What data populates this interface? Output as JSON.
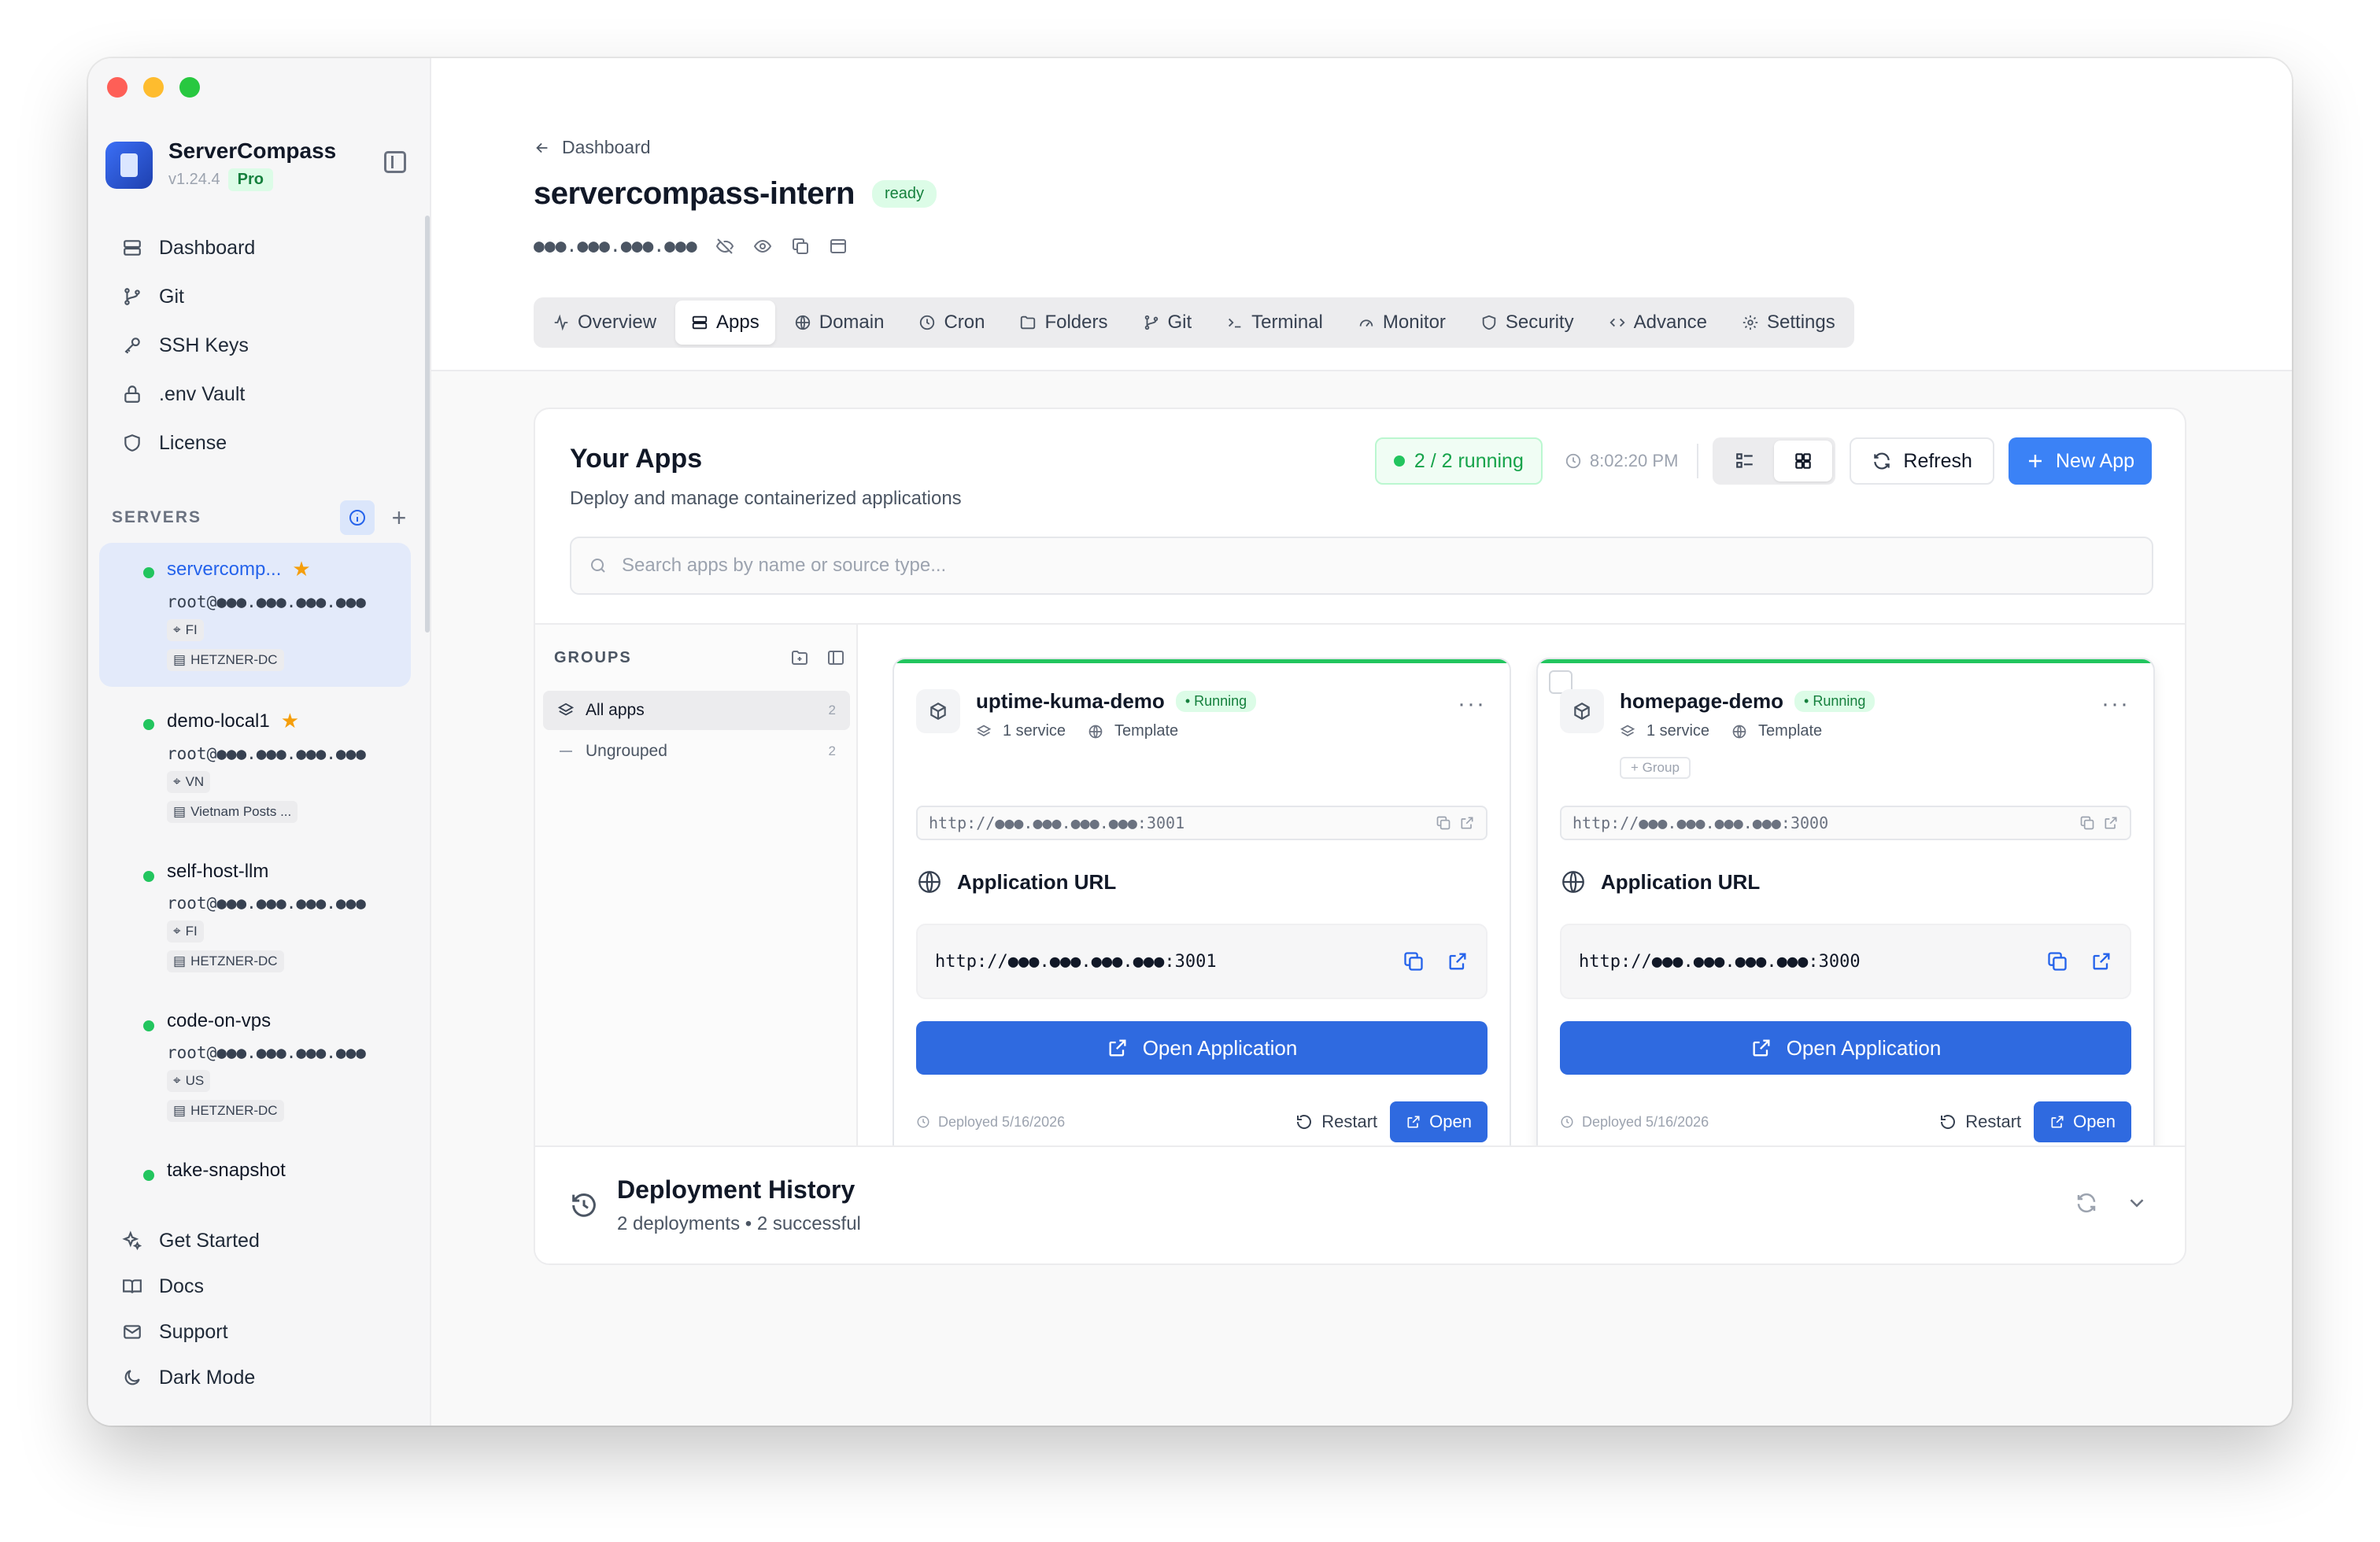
{
  "app": {
    "name": "ServerCompass",
    "version": "v1.24.4",
    "plan": "Pro"
  },
  "sidebar": {
    "nav": [
      {
        "label": "Dashboard",
        "icon": "dashboard-icon"
      },
      {
        "label": "Git",
        "icon": "git-branch-icon"
      },
      {
        "label": "SSH Keys",
        "icon": "key-icon"
      },
      {
        "label": ".env Vault",
        "icon": "lock-icon"
      },
      {
        "label": "License",
        "icon": "shield-icon"
      }
    ],
    "servers_title": "SERVERS",
    "servers": [
      {
        "name": "servercomp...",
        "user_ip": "root@●●●.●●●.●●●.●●●",
        "location": "FI",
        "provider": "HETZNER-DC",
        "starred": true,
        "active": true
      },
      {
        "name": "demo-local1",
        "user_ip": "root@●●●.●●●.●●●.●●●",
        "location": "VN",
        "provider": "Vietnam Posts ...",
        "starred": true,
        "active": false
      },
      {
        "name": "self-host-llm",
        "user_ip": "root@●●●.●●●.●●●.●●●",
        "location": "FI",
        "provider": "HETZNER-DC",
        "starred": false,
        "active": false
      },
      {
        "name": "code-on-vps",
        "user_ip": "root@●●●.●●●.●●●.●●●",
        "location": "US",
        "provider": "HETZNER-DC",
        "starred": false,
        "active": false
      },
      {
        "name": "take-snapshot",
        "user_ip": "",
        "location": "",
        "provider": "",
        "starred": false,
        "active": false
      }
    ],
    "footer": [
      {
        "label": "Get Started",
        "icon": "sparkles-icon"
      },
      {
        "label": "Docs",
        "icon": "book-icon"
      },
      {
        "label": "Support",
        "icon": "mail-icon"
      },
      {
        "label": "Dark Mode",
        "icon": "moon-icon"
      }
    ]
  },
  "header": {
    "breadcrumb": "Dashboard",
    "title": "servercompass-intern",
    "status": "ready",
    "ip_masked": "●●●.●●●.●●●.●●●"
  },
  "tabs": [
    {
      "label": "Overview",
      "icon": "activity-icon",
      "active": false
    },
    {
      "label": "Apps",
      "icon": "server-icon",
      "active": true
    },
    {
      "label": "Domain",
      "icon": "globe-icon",
      "active": false
    },
    {
      "label": "Cron",
      "icon": "clock-icon",
      "active": false
    },
    {
      "label": "Folders",
      "icon": "folder-icon",
      "active": false
    },
    {
      "label": "Git",
      "icon": "git-branch-icon",
      "active": false
    },
    {
      "label": "Terminal",
      "icon": "terminal-icon",
      "active": false
    },
    {
      "label": "Monitor",
      "icon": "gauge-icon",
      "active": false
    },
    {
      "label": "Security",
      "icon": "shield-icon",
      "active": false
    },
    {
      "label": "Advance",
      "icon": "code-icon",
      "active": false
    },
    {
      "label": "Settings",
      "icon": "gear-icon",
      "active": false
    }
  ],
  "apps_panel": {
    "title": "Your Apps",
    "subtitle": "Deploy and manage containerized applications",
    "running": "2 / 2 running",
    "time": "8:02:20 PM",
    "refresh_label": "Refresh",
    "new_app_label": "New App",
    "search_placeholder": "Search apps by name or source type..."
  },
  "groups": {
    "title": "GROUPS",
    "items": [
      {
        "label": "All apps",
        "count": "2",
        "active": true
      },
      {
        "label": "Ungrouped",
        "count": "2",
        "active": false
      }
    ]
  },
  "apps": [
    {
      "name": "uptime-kuma-demo",
      "status": "Running",
      "services": "1 service",
      "source": "Template",
      "internal_url": "http://●●●.●●●.●●●.●●●:3001",
      "app_url_title": "Application URL",
      "app_url": "http://●●●.●●●.●●●.●●●:3001",
      "open_app_label": "Open Application",
      "deployed": "Deployed 5/16/2026",
      "restart_label": "Restart",
      "open_label": "Open"
    },
    {
      "name": "homepage-demo",
      "status": "Running",
      "services": "1 service",
      "source": "Template",
      "group_tag": "+ Group",
      "internal_url": "http://●●●.●●●.●●●.●●●:3000",
      "app_url_title": "Application URL",
      "app_url": "http://●●●.●●●.●●●.●●●:3000",
      "open_app_label": "Open Application",
      "deployed": "Deployed 5/16/2026",
      "restart_label": "Restart",
      "open_label": "Open"
    }
  ],
  "history": {
    "title": "Deployment History",
    "subtitle": "2 deployments • 2 successful"
  },
  "colors": {
    "accent": "#2f6ae0",
    "success": "#22c55e",
    "star": "#f59e0b"
  }
}
